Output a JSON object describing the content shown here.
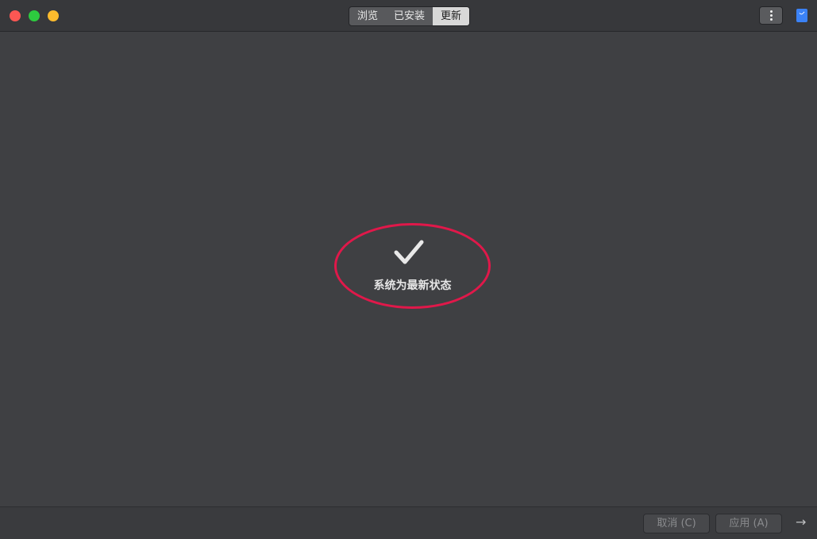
{
  "titlebar": {
    "tabs": [
      {
        "label": "浏览"
      },
      {
        "label": "已安装"
      },
      {
        "label": "更新"
      }
    ],
    "active_tab_index": 2
  },
  "main": {
    "status_text": "系统为最新状态",
    "icon": "checkmark-icon"
  },
  "footer": {
    "cancel_label": "取消 (C)",
    "apply_label": "应用 (A)",
    "next_icon": "arrow-right-icon"
  },
  "colors": {
    "accent_highlight": "#e0184a",
    "close": "#fc5753",
    "maximize": "#2dcb3f",
    "minimize": "#fdbb2d",
    "store_icon": "#3b82f6"
  }
}
